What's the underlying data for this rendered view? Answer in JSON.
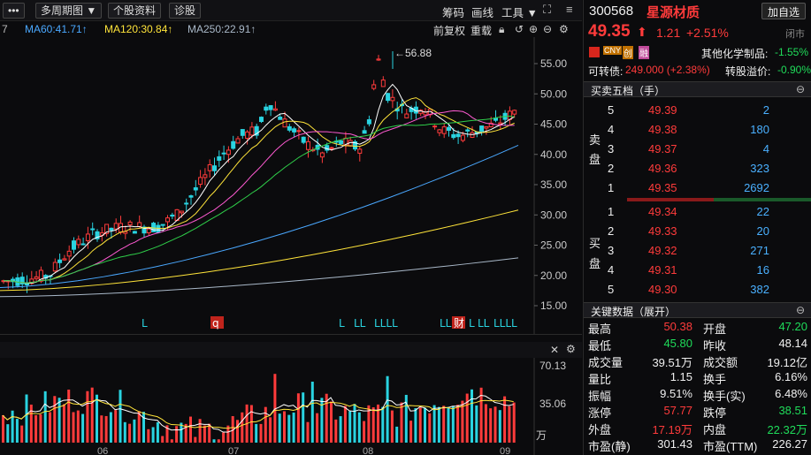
{
  "toolbar": {
    "more_label": "•••",
    "period_label": "多周期图 ▼",
    "profile_label": "个股资料",
    "diagnose_label": "诊股",
    "chips_label": "筹码",
    "draw_label": "画线",
    "tools_label": "工具 ▼"
  },
  "ma_line": {
    "ma_first_partial": "7",
    "ma60": "MA60:41.71↑",
    "ma120": "MA120:30.84↑",
    "ma250": "MA250:22.91↑",
    "adjust_label": "前复权",
    "adjust2_label": "重载",
    "colors": {
      "ma60": "#4aa8ff",
      "ma120": "#ffe43a",
      "ma250": "#a9b8c8"
    }
  },
  "main_chart": {
    "peak_label": "←56.88",
    "y_ticks": [
      "55.00",
      "50.00",
      "45.00",
      "40.00",
      "35.00",
      "30.00",
      "25.00",
      "20.00",
      "15.00"
    ],
    "markers": [
      {
        "text": "L",
        "type": "plain"
      },
      {
        "text": "q",
        "type": "boxed"
      },
      {
        "text": "L",
        "type": "plain"
      },
      {
        "text": "LL",
        "type": "plain"
      },
      {
        "text": "LLLL",
        "type": "plain"
      },
      {
        "text": "LL",
        "type": "plain"
      },
      {
        "text": "财",
        "type": "boxed"
      },
      {
        "text": "L",
        "type": "plain"
      },
      {
        "text": "LL",
        "type": "plain"
      },
      {
        "text": "LLLL",
        "type": "plain"
      }
    ]
  },
  "volume_chart": {
    "y_ticks": [
      "70.13",
      "35.06"
    ],
    "unit": "万",
    "x_ticks": [
      "06",
      "07",
      "08",
      "09"
    ]
  },
  "quote": {
    "code": "300568",
    "name": "星源材质",
    "add_watch_label": "加自选",
    "price": "49.35",
    "arrow": "⬆",
    "change": "1.21",
    "change_pct": "+2.51%",
    "status": "闭市",
    "sector_label": "其他化学制品:",
    "sector_change": "-1.55%",
    "badges": [
      "CNY",
      "创",
      "融"
    ],
    "convertible_label": "可转债:",
    "convertible_value": "249.000 (+2.38%)",
    "premium_label": "转股溢价:",
    "premium_value": "-0.90%"
  },
  "orderbook": {
    "title": "买卖五档（手）",
    "sell_label_1": "卖",
    "sell_label_2": "盘",
    "buy_label_1": "买",
    "buy_label_2": "盘",
    "asks": [
      {
        "level": "5",
        "price": "49.39",
        "volume": "2"
      },
      {
        "level": "4",
        "price": "49.38",
        "volume": "180"
      },
      {
        "level": "3",
        "price": "49.37",
        "volume": "4"
      },
      {
        "level": "2",
        "price": "49.36",
        "volume": "323"
      },
      {
        "level": "1",
        "price": "49.35",
        "volume": "2692"
      }
    ],
    "bids": [
      {
        "level": "1",
        "price": "49.34",
        "volume": "22"
      },
      {
        "level": "2",
        "price": "49.33",
        "volume": "20"
      },
      {
        "level": "3",
        "price": "49.32",
        "volume": "271"
      },
      {
        "level": "4",
        "price": "49.31",
        "volume": "16"
      },
      {
        "level": "5",
        "price": "49.30",
        "volume": "382"
      }
    ]
  },
  "key_data": {
    "title": "关键数据（展开）",
    "rows": [
      {
        "l1": "最高",
        "v1": "50.38",
        "c1": "red",
        "l2": "开盘",
        "v2": "47.20",
        "c2": "green"
      },
      {
        "l1": "最低",
        "v1": "45.80",
        "c1": "green",
        "l2": "昨收",
        "v2": "48.14",
        "c2": "white"
      },
      {
        "l1": "成交量",
        "v1": "39.51万",
        "c1": "white",
        "l2": "成交额",
        "v2": "19.12亿",
        "c2": "white"
      },
      {
        "l1": "量比",
        "v1": "1.15",
        "c1": "white",
        "l2": "换手",
        "v2": "6.16%",
        "c2": "white"
      },
      {
        "l1": "振幅",
        "v1": "9.51%",
        "c1": "white",
        "l2": "换手(实)",
        "v2": "6.48%",
        "c2": "white"
      },
      {
        "l1": "涨停",
        "v1": "57.77",
        "c1": "red",
        "l2": "跌停",
        "v2": "38.51",
        "c2": "green"
      },
      {
        "l1": "外盘",
        "v1": "17.19万",
        "c1": "red",
        "l2": "内盘",
        "v2": "22.32万",
        "c2": "green"
      },
      {
        "l1": "市盈(静)",
        "v1": "301.43",
        "c1": "white",
        "l2": "市盈(TTM)",
        "v2": "226.27",
        "c2": "white"
      }
    ]
  }
}
